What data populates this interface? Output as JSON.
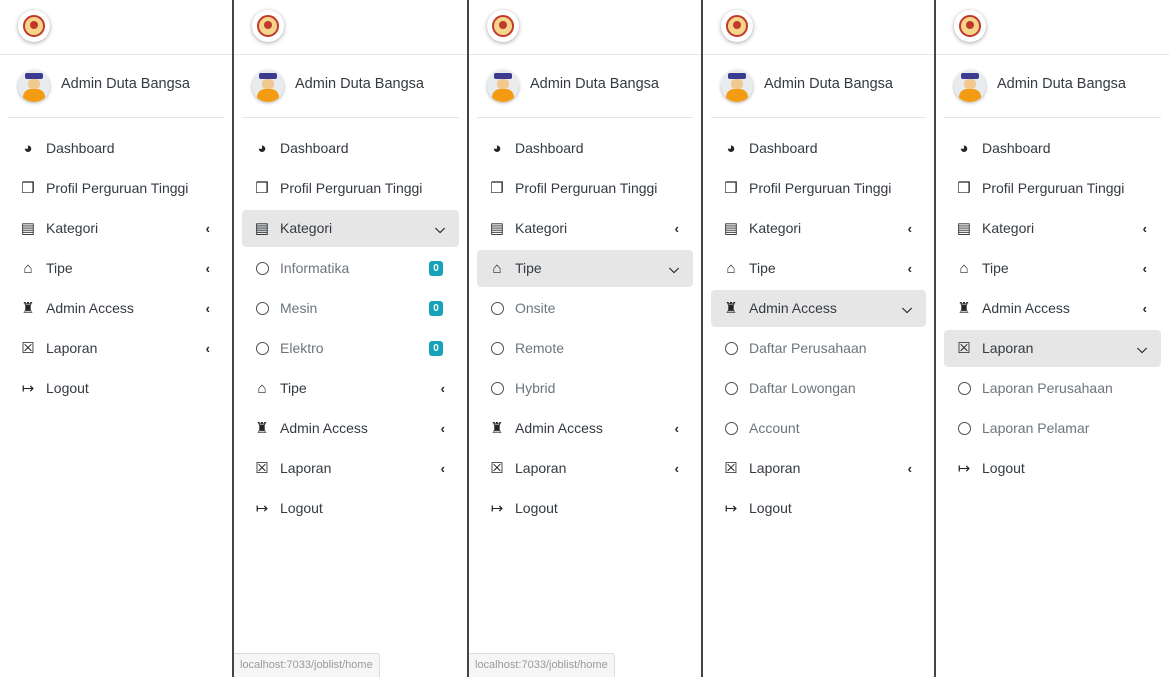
{
  "username": "Admin Duta Bangsa",
  "status_url": "localhost:7033/joblist/home",
  "colors": {
    "active_bg": "#e6e6e6",
    "badge": "#17a2b8"
  },
  "icons": {
    "dashboard": "🚄",
    "profil": "❒",
    "kategori": "▤",
    "tipe": "⌂",
    "admin": "♜",
    "laporan": "☒",
    "logout": "↦"
  },
  "panels": [
    {
      "items": [
        {
          "icon": "gauge-icon",
          "glyph": "◕",
          "label": "Dashboard"
        },
        {
          "icon": "chalkboard-icon",
          "glyph": "❒",
          "label": "Profil Perguruan Tinggi"
        },
        {
          "icon": "book-icon",
          "glyph": "▤",
          "label": "Kategori",
          "arrow": "‹"
        },
        {
          "icon": "house-icon",
          "glyph": "⌂",
          "label": "Tipe",
          "arrow": "‹"
        },
        {
          "icon": "user-secret-icon",
          "glyph": "♜",
          "label": "Admin Access",
          "arrow": "‹"
        },
        {
          "icon": "file-excel-icon",
          "glyph": "☒",
          "label": "Laporan",
          "arrow": "‹"
        },
        {
          "icon": "logout-icon",
          "glyph": "↦",
          "label": "Logout"
        }
      ]
    },
    {
      "status": true,
      "items": [
        {
          "icon": "gauge-icon",
          "glyph": "◕",
          "label": "Dashboard"
        },
        {
          "icon": "chalkboard-icon",
          "glyph": "❒",
          "label": "Profil Perguruan Tinggi"
        },
        {
          "icon": "book-icon",
          "glyph": "▤",
          "label": "Kategori",
          "arrow": "⌵",
          "active": true
        },
        {
          "sub": true,
          "label": "Informatika",
          "badge": "0"
        },
        {
          "sub": true,
          "label": "Mesin",
          "badge": "0"
        },
        {
          "sub": true,
          "label": "Elektro",
          "badge": "0"
        },
        {
          "icon": "house-icon",
          "glyph": "⌂",
          "label": "Tipe",
          "arrow": "‹"
        },
        {
          "icon": "user-secret-icon",
          "glyph": "♜",
          "label": "Admin Access",
          "arrow": "‹"
        },
        {
          "icon": "file-excel-icon",
          "glyph": "☒",
          "label": "Laporan",
          "arrow": "‹"
        },
        {
          "icon": "logout-icon",
          "glyph": "↦",
          "label": "Logout"
        }
      ]
    },
    {
      "status": true,
      "items": [
        {
          "icon": "gauge-icon",
          "glyph": "◕",
          "label": "Dashboard"
        },
        {
          "icon": "chalkboard-icon",
          "glyph": "❒",
          "label": "Profil Perguruan Tinggi"
        },
        {
          "icon": "book-icon",
          "glyph": "▤",
          "label": "Kategori",
          "arrow": "‹"
        },
        {
          "icon": "house-icon",
          "glyph": "⌂",
          "label": "Tipe",
          "arrow": "⌵",
          "active": true
        },
        {
          "sub": true,
          "label": "Onsite"
        },
        {
          "sub": true,
          "label": "Remote"
        },
        {
          "sub": true,
          "label": "Hybrid"
        },
        {
          "icon": "user-secret-icon",
          "glyph": "♜",
          "label": "Admin Access",
          "arrow": "‹"
        },
        {
          "icon": "file-excel-icon",
          "glyph": "☒",
          "label": "Laporan",
          "arrow": "‹"
        },
        {
          "icon": "logout-icon",
          "glyph": "↦",
          "label": "Logout"
        }
      ]
    },
    {
      "items": [
        {
          "icon": "gauge-icon",
          "glyph": "◕",
          "label": "Dashboard"
        },
        {
          "icon": "chalkboard-icon",
          "glyph": "❒",
          "label": "Profil Perguruan Tinggi"
        },
        {
          "icon": "book-icon",
          "glyph": "▤",
          "label": "Kategori",
          "arrow": "‹"
        },
        {
          "icon": "house-icon",
          "glyph": "⌂",
          "label": "Tipe",
          "arrow": "‹"
        },
        {
          "icon": "user-secret-icon",
          "glyph": "♜",
          "label": "Admin Access",
          "arrow": "⌵",
          "active": true
        },
        {
          "sub": true,
          "label": "Daftar Perusahaan"
        },
        {
          "sub": true,
          "label": "Daftar Lowongan"
        },
        {
          "sub": true,
          "label": "Account"
        },
        {
          "icon": "file-excel-icon",
          "glyph": "☒",
          "label": "Laporan",
          "arrow": "‹"
        },
        {
          "icon": "logout-icon",
          "glyph": "↦",
          "label": "Logout"
        }
      ]
    },
    {
      "items": [
        {
          "icon": "gauge-icon",
          "glyph": "◕",
          "label": "Dashboard"
        },
        {
          "icon": "chalkboard-icon",
          "glyph": "❒",
          "label": "Profil Perguruan Tinggi"
        },
        {
          "icon": "book-icon",
          "glyph": "▤",
          "label": "Kategori",
          "arrow": "‹"
        },
        {
          "icon": "house-icon",
          "glyph": "⌂",
          "label": "Tipe",
          "arrow": "‹"
        },
        {
          "icon": "user-secret-icon",
          "glyph": "♜",
          "label": "Admin Access",
          "arrow": "‹"
        },
        {
          "icon": "file-excel-icon",
          "glyph": "☒",
          "label": "Laporan",
          "arrow": "⌵",
          "active": true
        },
        {
          "sub": true,
          "label": "Laporan Perusahaan"
        },
        {
          "sub": true,
          "label": "Laporan Pelamar"
        },
        {
          "icon": "logout-icon",
          "glyph": "↦",
          "label": "Logout"
        }
      ]
    }
  ]
}
